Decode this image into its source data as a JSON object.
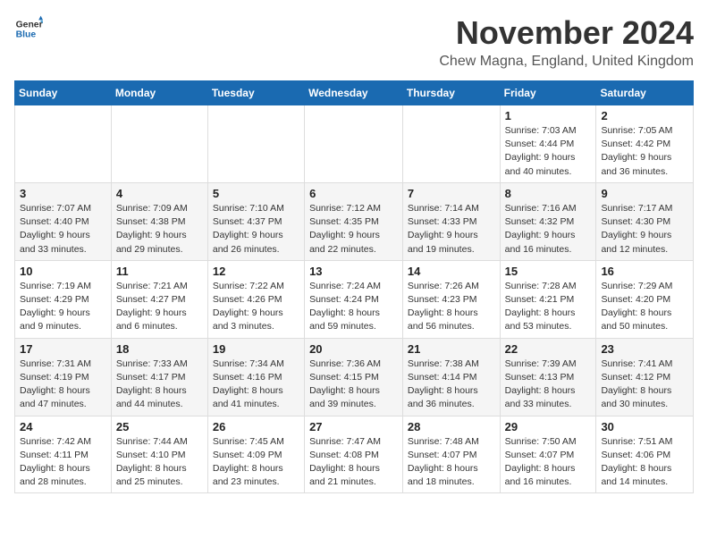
{
  "logo": {
    "general": "General",
    "blue": "Blue"
  },
  "title": "November 2024",
  "location": "Chew Magna, England, United Kingdom",
  "days_of_week": [
    "Sunday",
    "Monday",
    "Tuesday",
    "Wednesday",
    "Thursday",
    "Friday",
    "Saturday"
  ],
  "weeks": [
    [
      {
        "day": "",
        "info": ""
      },
      {
        "day": "",
        "info": ""
      },
      {
        "day": "",
        "info": ""
      },
      {
        "day": "",
        "info": ""
      },
      {
        "day": "",
        "info": ""
      },
      {
        "day": "1",
        "info": "Sunrise: 7:03 AM\nSunset: 4:44 PM\nDaylight: 9 hours and 40 minutes."
      },
      {
        "day": "2",
        "info": "Sunrise: 7:05 AM\nSunset: 4:42 PM\nDaylight: 9 hours and 36 minutes."
      }
    ],
    [
      {
        "day": "3",
        "info": "Sunrise: 7:07 AM\nSunset: 4:40 PM\nDaylight: 9 hours and 33 minutes."
      },
      {
        "day": "4",
        "info": "Sunrise: 7:09 AM\nSunset: 4:38 PM\nDaylight: 9 hours and 29 minutes."
      },
      {
        "day": "5",
        "info": "Sunrise: 7:10 AM\nSunset: 4:37 PM\nDaylight: 9 hours and 26 minutes."
      },
      {
        "day": "6",
        "info": "Sunrise: 7:12 AM\nSunset: 4:35 PM\nDaylight: 9 hours and 22 minutes."
      },
      {
        "day": "7",
        "info": "Sunrise: 7:14 AM\nSunset: 4:33 PM\nDaylight: 9 hours and 19 minutes."
      },
      {
        "day": "8",
        "info": "Sunrise: 7:16 AM\nSunset: 4:32 PM\nDaylight: 9 hours and 16 minutes."
      },
      {
        "day": "9",
        "info": "Sunrise: 7:17 AM\nSunset: 4:30 PM\nDaylight: 9 hours and 12 minutes."
      }
    ],
    [
      {
        "day": "10",
        "info": "Sunrise: 7:19 AM\nSunset: 4:29 PM\nDaylight: 9 hours and 9 minutes."
      },
      {
        "day": "11",
        "info": "Sunrise: 7:21 AM\nSunset: 4:27 PM\nDaylight: 9 hours and 6 minutes."
      },
      {
        "day": "12",
        "info": "Sunrise: 7:22 AM\nSunset: 4:26 PM\nDaylight: 9 hours and 3 minutes."
      },
      {
        "day": "13",
        "info": "Sunrise: 7:24 AM\nSunset: 4:24 PM\nDaylight: 8 hours and 59 minutes."
      },
      {
        "day": "14",
        "info": "Sunrise: 7:26 AM\nSunset: 4:23 PM\nDaylight: 8 hours and 56 minutes."
      },
      {
        "day": "15",
        "info": "Sunrise: 7:28 AM\nSunset: 4:21 PM\nDaylight: 8 hours and 53 minutes."
      },
      {
        "day": "16",
        "info": "Sunrise: 7:29 AM\nSunset: 4:20 PM\nDaylight: 8 hours and 50 minutes."
      }
    ],
    [
      {
        "day": "17",
        "info": "Sunrise: 7:31 AM\nSunset: 4:19 PM\nDaylight: 8 hours and 47 minutes."
      },
      {
        "day": "18",
        "info": "Sunrise: 7:33 AM\nSunset: 4:17 PM\nDaylight: 8 hours and 44 minutes."
      },
      {
        "day": "19",
        "info": "Sunrise: 7:34 AM\nSunset: 4:16 PM\nDaylight: 8 hours and 41 minutes."
      },
      {
        "day": "20",
        "info": "Sunrise: 7:36 AM\nSunset: 4:15 PM\nDaylight: 8 hours and 39 minutes."
      },
      {
        "day": "21",
        "info": "Sunrise: 7:38 AM\nSunset: 4:14 PM\nDaylight: 8 hours and 36 minutes."
      },
      {
        "day": "22",
        "info": "Sunrise: 7:39 AM\nSunset: 4:13 PM\nDaylight: 8 hours and 33 minutes."
      },
      {
        "day": "23",
        "info": "Sunrise: 7:41 AM\nSunset: 4:12 PM\nDaylight: 8 hours and 30 minutes."
      }
    ],
    [
      {
        "day": "24",
        "info": "Sunrise: 7:42 AM\nSunset: 4:11 PM\nDaylight: 8 hours and 28 minutes."
      },
      {
        "day": "25",
        "info": "Sunrise: 7:44 AM\nSunset: 4:10 PM\nDaylight: 8 hours and 25 minutes."
      },
      {
        "day": "26",
        "info": "Sunrise: 7:45 AM\nSunset: 4:09 PM\nDaylight: 8 hours and 23 minutes."
      },
      {
        "day": "27",
        "info": "Sunrise: 7:47 AM\nSunset: 4:08 PM\nDaylight: 8 hours and 21 minutes."
      },
      {
        "day": "28",
        "info": "Sunrise: 7:48 AM\nSunset: 4:07 PM\nDaylight: 8 hours and 18 minutes."
      },
      {
        "day": "29",
        "info": "Sunrise: 7:50 AM\nSunset: 4:07 PM\nDaylight: 8 hours and 16 minutes."
      },
      {
        "day": "30",
        "info": "Sunrise: 7:51 AM\nSunset: 4:06 PM\nDaylight: 8 hours and 14 minutes."
      }
    ]
  ]
}
